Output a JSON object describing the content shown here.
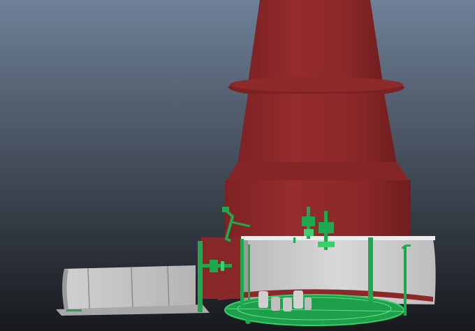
{
  "viewport": {
    "background_top": "#6f8097",
    "background_bottom": "#17191c"
  },
  "scene": {
    "tower_color": "#8e2a2b",
    "tower_shadow": "#6e1f20",
    "cutaway_wall_color": "#cfcfcf",
    "cutaway_wall_shadow": "#a8a8a8",
    "selection_color": "#1fa84e",
    "selection_highlight": "#36d16a"
  }
}
